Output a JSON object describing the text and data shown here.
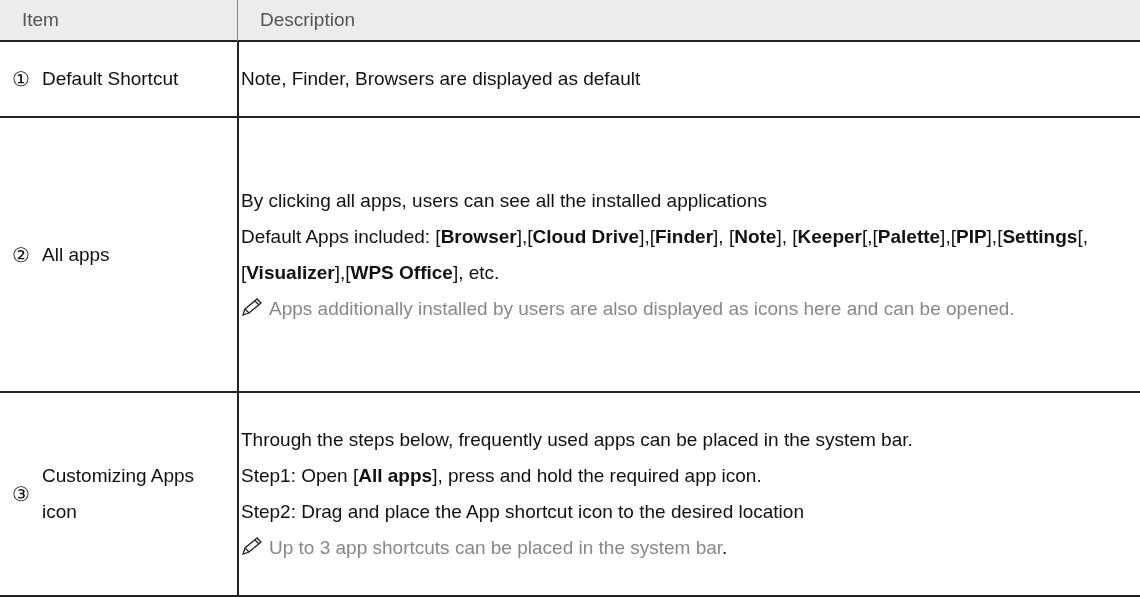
{
  "table": {
    "columns": [
      "Item",
      "Description"
    ],
    "rows": [
      {
        "number": "①",
        "item": "Default Shortcut",
        "lines": [
          {
            "kind": "text",
            "text": "Note, Finder, Browsers are displayed as default"
          }
        ]
      },
      {
        "number": "②",
        "item": "All apps",
        "lines": [
          {
            "kind": "text",
            "text": "By clicking all apps, users can see all the installed applications"
          },
          {
            "kind": "text",
            "text": "Default Apps included: [**Browser**],[**Cloud Drive**],[**Finder**], [**Note**], [**Keeper**[,[**Palette**],[**PIP**],[**Settings**[,[**Visualizer**],[**WPS Office**], etc."
          },
          {
            "kind": "note",
            "text": "Apps additionally installed by users are also displayed as icons here and can be opened."
          }
        ]
      },
      {
        "number": "③",
        "item": "Customizing Apps icon",
        "lines": [
          {
            "kind": "text",
            "text": "Through the steps below, frequently used apps can be placed in the system bar."
          },
          {
            "kind": "text",
            "text": "Step1: Open [**All apps**], press and hold the required app icon."
          },
          {
            "kind": "text",
            "text": "Step2: Drag and place the App shortcut icon to the desired location"
          },
          {
            "kind": "note",
            "text": "Up to 3 app shortcuts can be placed in the system bar",
            "tail": "."
          }
        ]
      }
    ]
  }
}
